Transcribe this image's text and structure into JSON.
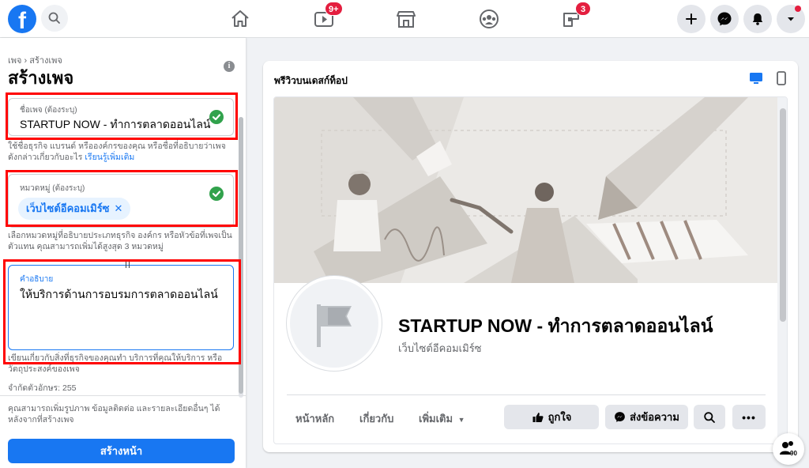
{
  "topbar": {
    "logo_letter": "f",
    "watch_badge": "9+",
    "gaming_badge": "3"
  },
  "left_panel": {
    "breadcrumb": "เพจ › สร้างเพจ",
    "title": "สร้างเพจ",
    "name_field": {
      "label": "ชื่อเพจ (ต้องระบุ)",
      "value": "STARTUP NOW - ทำการตลาดออนไลน์"
    },
    "name_help": "ใช้ชื่อธุรกิจ แบรนด์ หรือองค์กรของคุณ หรือชื่อที่อธิบายว่าเพจดังกล่าวเกี่ยวกับอะไร",
    "name_help_link": "เรียนรู้เพิ่มเติม",
    "category_field": {
      "label": "หมวดหมู่ (ต้องระบุ)",
      "chip": "เว็บไซต์อีคอมเมิร์ซ"
    },
    "category_help": "เลือกหมวดหมู่ที่อธิบายประเภทธุรกิจ องค์กร หรือหัวข้อที่เพจเป็นตัวแทน คุณสามารถเพิ่มได้สูงสุด 3 หมวดหมู่",
    "description_field": {
      "label": "คำอธิบาย",
      "value": "ให้บริการด้านการอบรมการตลาดออนไลน์"
    },
    "description_help": "เขียนเกี่ยวกับสิ่งที่ธุรกิจของคุณทำ บริการที่คุณให้บริการ หรือวัตถุประสงค์ของเพจ",
    "char_limit": "จำกัดตัวอักษร: 255",
    "footer_note": "คุณสามารถเพิ่มรูปภาพ ข้อมูลติดต่อ และรายละเอียดอื่นๆ ได้หลังจากที่สร้างเพจ",
    "create_button": "สร้างหน้า"
  },
  "preview": {
    "title": "พรีวิวบนเดสก์ท็อป",
    "page_name": "STARTUP NOW - ทำการตลาดออนไลน์",
    "page_category": "เว็บไซต์อีคอมเมิร์ซ",
    "nav": [
      "หน้าหลัก",
      "เกี่ยวกับ",
      "เพิ่มเติม"
    ],
    "like_button": "ถูกใจ",
    "message_button": "ส่งข้อความ"
  },
  "contacts_count": "90",
  "colors": {
    "brand": "#1877f2",
    "badge": "#e41e3f",
    "success": "#31a24c",
    "highlight": "#ff0000"
  }
}
